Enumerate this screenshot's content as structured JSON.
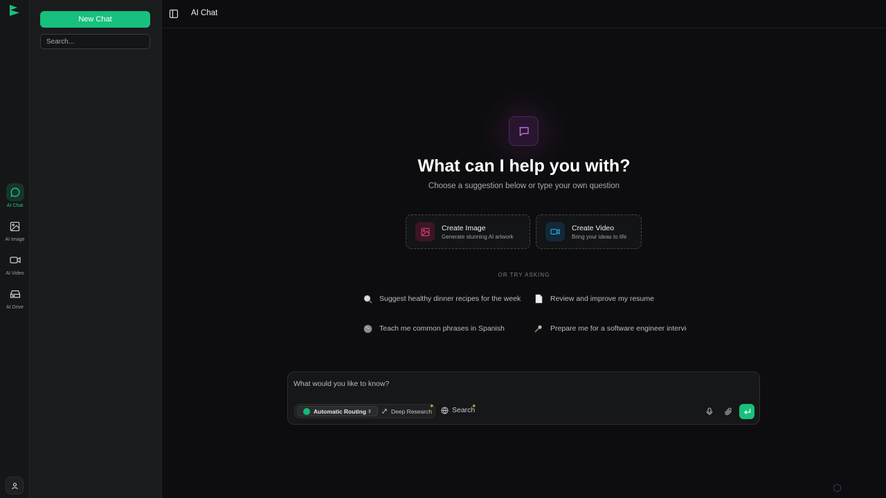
{
  "app": {
    "title": "AI Chat",
    "brand_color": "#17c07d"
  },
  "rail": {
    "items": [
      {
        "label": "AI Chat",
        "icon": "chat-bubble-icon",
        "active": true
      },
      {
        "label": "AI Image",
        "icon": "image-icon",
        "active": false
      },
      {
        "label": "AI Video",
        "icon": "video-camera-icon",
        "active": false
      },
      {
        "label": "AI Drive",
        "icon": "drive-icon",
        "active": false
      }
    ]
  },
  "sidebar": {
    "new_chat_label": "New Chat",
    "search_placeholder": "Search..."
  },
  "header": {
    "title": "AI Chat"
  },
  "hero": {
    "title": "What can I help you with?",
    "subtitle": "Choose a suggestion below or type your own question"
  },
  "cards": [
    {
      "title": "Create Image",
      "subtitle": "Generate stunning AI artwork",
      "icon": "image-icon",
      "color": "#e0407a"
    },
    {
      "title": "Create Video",
      "subtitle": "Bring your ideas to life",
      "icon": "video-camera-icon",
      "color": "#2fa8e0"
    }
  ],
  "or_label": "OR TRY ASKING",
  "suggestions": [
    {
      "text": "Suggest healthy dinner recipes for the week",
      "icon": "magnifier-icon"
    },
    {
      "text": "Review and improve my resume",
      "icon": "document-icon"
    },
    {
      "text": "Teach me common phrases in Spanish",
      "icon": "globe-icon"
    },
    {
      "text": "Prepare me for a software engineer intervie",
      "icon": "microphone-icon"
    }
  ],
  "composer": {
    "placeholder": "What would you like to know?",
    "routing_label": "Automatic Routing",
    "research_label": "Deep Research",
    "search_label": "Search"
  }
}
